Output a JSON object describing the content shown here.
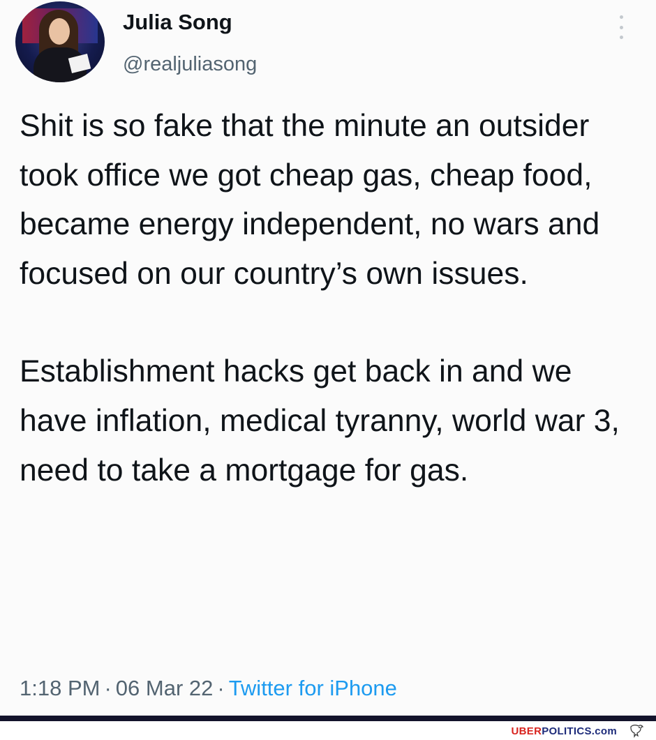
{
  "tweet": {
    "display_name": "Julia Song",
    "handle": "@realjuliasong",
    "paragraphs": [
      "Shit is so fake that the minute an outsider took office we got cheap gas, cheap food, became energy independent, no wars and focused on our country’s own issues.",
      "Establishment hacks get back in and we have inflation, medical tyranny, world war 3, need to take a mortgage for gas."
    ],
    "time": "1:18 PM",
    "date": "06 Mar 22",
    "source": "Twitter for iPhone",
    "separator": "·",
    "more_icon": "more-vertical-icon",
    "avatar_icon": "profile-photo"
  },
  "watermark": {
    "part1": "UBER",
    "part2": "POLITICS",
    "part3": ".com",
    "icon": "eagle-icon",
    "colors": {
      "part1": "#d8231e",
      "part2": "#1d2b7a"
    }
  },
  "colors": {
    "text": "#0f1419",
    "secondary": "#536471",
    "link": "#1d9bf0",
    "rule": "#13132b"
  }
}
